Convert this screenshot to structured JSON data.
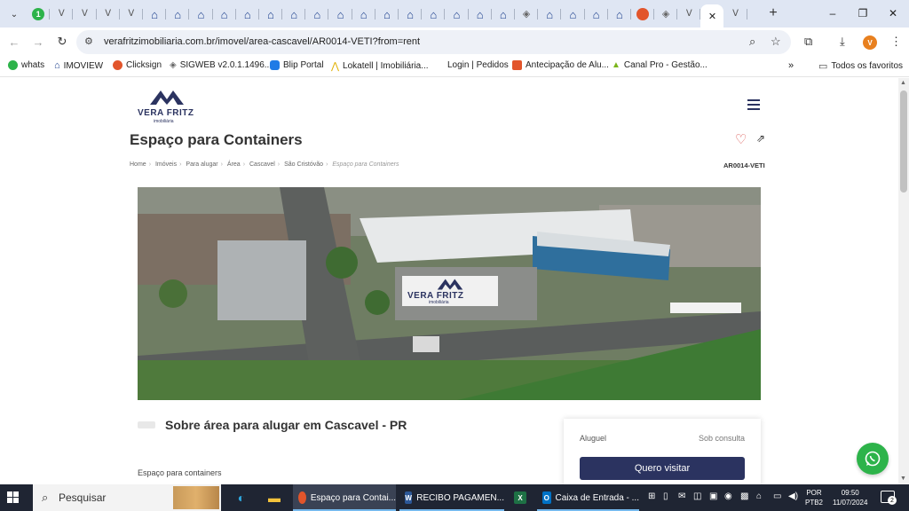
{
  "browser": {
    "tab_count_icons": [
      "green-1",
      "vf",
      "vf",
      "vf",
      "vf",
      "house",
      "house",
      "house",
      "house",
      "house",
      "house",
      "house",
      "house",
      "house",
      "house",
      "house",
      "house",
      "house",
      "house",
      "house",
      "house",
      "vf-gray",
      "house",
      "house",
      "house",
      "house",
      "orange",
      "vf-gray",
      "vf",
      "active",
      "vf"
    ],
    "url": "verafritzimobiliaria.com.br/imovel/area-cascavel/AR0014-VETI?from=rent",
    "profile_initial": "V",
    "new_tab_symbol": "+",
    "window_controls": {
      "minimize": "–",
      "restore": "❐",
      "close": "✕"
    }
  },
  "bookmarks": [
    {
      "label": "whats",
      "icon_color": "#2db34a"
    },
    {
      "label": "IMOVIEW",
      "icon_color": "#1a3e8c"
    },
    {
      "label": "Clicksign",
      "icon_color": "#e2552b"
    },
    {
      "label": "SIGWEB v2.0.1.1496...",
      "icon_color": "#666666"
    },
    {
      "label": "Blip Portal",
      "icon_color": "#1f7be6"
    },
    {
      "label": "Lokatell | Imobiliária...",
      "icon_color": "#e0b000"
    },
    {
      "label": "Login | Pedidos",
      "icon_color": ""
    },
    {
      "label": "Antecipação de Alu...",
      "icon_color": "#e2552b"
    },
    {
      "label": "Canal Pro - Gestão...",
      "icon_color": "#7bb51b"
    },
    {
      "label": "Todos os favoritos",
      "icon_color": ""
    }
  ],
  "site": {
    "logo_name": "VERA FRITZ",
    "logo_sub": "imobiliária",
    "title": "Espaço para Containers",
    "breadcrumb": [
      "Home",
      "Imóveis",
      "Para alugar",
      "Área",
      "Cascavel",
      "São Cristóvão"
    ],
    "breadcrumb_current": "Espaço para Containers",
    "code": "AR0014-VETI",
    "watermark_name": "VERA FRITZ",
    "watermark_sub": "imobiliária",
    "section_title": "Sobre área para alugar em Cascavel - PR",
    "description": "Espaço para containers",
    "card": {
      "label": "Aluguel",
      "value": "Sob consulta",
      "button": "Quero visitar"
    }
  },
  "taskbar": {
    "search_placeholder": "Pesquisar",
    "tasks": [
      {
        "label": "Espaço para Contai...",
        "active": true
      },
      {
        "label": "RECIBO PAGAMEN...",
        "active": false
      },
      {
        "label": "Caixa de Entrada - ...",
        "active": false
      }
    ],
    "lang_top": "POR",
    "lang_bottom": "PTB2",
    "time": "09:50",
    "date": "11/07/2024",
    "notification_count": "2"
  },
  "colors": {
    "brand_navy": "#2b3360",
    "whatsapp_green": "#2db34a",
    "heart_red": "#d9534f"
  }
}
